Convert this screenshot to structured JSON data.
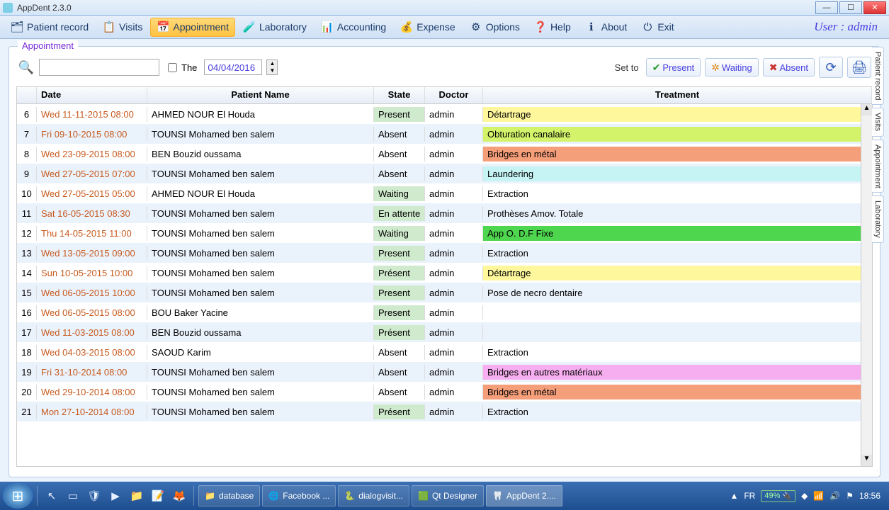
{
  "window": {
    "title": "AppDent 2.3.0"
  },
  "toolbar": {
    "items": [
      {
        "label": "Patient record",
        "icon": "🗂"
      },
      {
        "label": "Visits",
        "icon": "📋"
      },
      {
        "label": "Appointment",
        "icon": "📅",
        "active": true
      },
      {
        "label": "Laboratory",
        "icon": "🧪"
      },
      {
        "label": "Accounting",
        "icon": "📊"
      },
      {
        "label": "Expense",
        "icon": "💰"
      },
      {
        "label": "Options",
        "icon": "⚙"
      },
      {
        "label": "Help",
        "icon": "❓"
      },
      {
        "label": "About",
        "icon": "ℹ"
      },
      {
        "label": "Exit",
        "icon": "⏻"
      }
    ],
    "user_label": "User : admin"
  },
  "panel": {
    "title": "Appointment",
    "the_label": "The",
    "date_value": "04/04/2016",
    "set_to_label": "Set to",
    "btn_present": "Present",
    "btn_waiting": "Waiting",
    "btn_absent": "Absent"
  },
  "columns": {
    "date": "Date",
    "name": "Patient Name",
    "state": "State",
    "doctor": "Doctor",
    "treatment": "Treatment"
  },
  "rows": [
    {
      "n": 6,
      "date": "Wed 11-11-2015 08:00",
      "name": "AHMED NOUR El Houda",
      "state": "Present",
      "doctor": "admin",
      "treatment": "Détartrage",
      "tcolor": "#fef79c"
    },
    {
      "n": 7,
      "date": "Fri 09-10-2015 08:00",
      "name": "TOUNSI Mohamed ben salem",
      "state": "Absent",
      "doctor": "admin",
      "treatment": "Obturation canalaire",
      "tcolor": "#d3f36b"
    },
    {
      "n": 8,
      "date": "Wed 23-09-2015 08:00",
      "name": "BEN Bouzid oussama",
      "state": "Absent",
      "doctor": "admin",
      "treatment": "Bridges en métal",
      "tcolor": "#f59e7a"
    },
    {
      "n": 9,
      "date": "Wed 27-05-2015 07:00",
      "name": "TOUNSI Mohamed ben salem",
      "state": "Absent",
      "doctor": "admin",
      "treatment": "Laundering",
      "tcolor": "#c6f4f4"
    },
    {
      "n": 10,
      "date": "Wed 27-05-2015 05:00",
      "name": "AHMED NOUR El Houda",
      "state": "Waiting",
      "doctor": "admin",
      "treatment": "Extraction",
      "tcolor": ""
    },
    {
      "n": 11,
      "date": "Sat 16-05-2015 08:30",
      "name": "TOUNSI Mohamed ben salem",
      "state": "En attente",
      "doctor": "admin",
      "treatment": "Prothèses Amov. Totale",
      "tcolor": ""
    },
    {
      "n": 12,
      "date": "Thu 14-05-2015 11:00",
      "name": "TOUNSI Mohamed ben salem",
      "state": "Waiting",
      "doctor": "admin",
      "treatment": "App O. D.F Fixe",
      "tcolor": "#4fd64f"
    },
    {
      "n": 13,
      "date": "Wed 13-05-2015 09:00",
      "name": "TOUNSI Mohamed ben salem",
      "state": "Present",
      "doctor": "admin",
      "treatment": "Extraction",
      "tcolor": ""
    },
    {
      "n": 14,
      "date": "Sun 10-05-2015 10:00",
      "name": "TOUNSI Mohamed ben salem",
      "state": "Présent",
      "doctor": "admin",
      "treatment": "Détartrage",
      "tcolor": "#fef79c"
    },
    {
      "n": 15,
      "date": "Wed 06-05-2015 10:00",
      "name": "TOUNSI Mohamed ben salem",
      "state": "Present",
      "doctor": "admin",
      "treatment": "Pose de necro dentaire",
      "tcolor": ""
    },
    {
      "n": 16,
      "date": "Wed 06-05-2015 08:00",
      "name": "BOU Baker Yacine",
      "state": "Present",
      "doctor": "admin",
      "treatment": "",
      "tcolor": ""
    },
    {
      "n": 17,
      "date": "Wed 11-03-2015 08:00",
      "name": "BEN Bouzid oussama",
      "state": "Présent",
      "doctor": "admin",
      "treatment": "",
      "tcolor": ""
    },
    {
      "n": 18,
      "date": "Wed 04-03-2015 08:00",
      "name": "SAOUD Karim",
      "state": "Absent",
      "doctor": "admin",
      "treatment": "Extraction",
      "tcolor": ""
    },
    {
      "n": 19,
      "date": "Fri 31-10-2014 08:00",
      "name": "TOUNSI Mohamed ben salem",
      "state": "Absent",
      "doctor": "admin",
      "treatment": "Bridges en autres matériaux",
      "tcolor": "#f7aef0"
    },
    {
      "n": 20,
      "date": "Wed 29-10-2014 08:00",
      "name": "TOUNSI Mohamed ben salem",
      "state": "Absent",
      "doctor": "admin",
      "treatment": "Bridges en métal",
      "tcolor": "#f59e7a"
    },
    {
      "n": 21,
      "date": "Mon 27-10-2014 08:00",
      "name": "TOUNSI Mohamed ben salem",
      "state": "Présent",
      "doctor": "admin",
      "treatment": "Extraction",
      "tcolor": ""
    }
  ],
  "sidetabs": [
    "Patient record",
    "Visits",
    "Appointment",
    "Laboratory"
  ],
  "taskbar": {
    "tasks": [
      {
        "label": "database",
        "icon": "📁",
        "color": "#f7c667"
      },
      {
        "label": "Facebook ...",
        "icon": "🌐",
        "color": "#5aa0f2"
      },
      {
        "label": "dialogvisit...",
        "icon": "🐍",
        "color": "#4aa564"
      },
      {
        "label": "Qt Designer",
        "icon": "🟩",
        "color": "#6cd06c"
      },
      {
        "label": "AppDent 2....",
        "icon": "🦷",
        "color": "#9fe6ff",
        "active": true
      }
    ],
    "lang": "FR",
    "battery": "49%",
    "time": "18:56"
  }
}
